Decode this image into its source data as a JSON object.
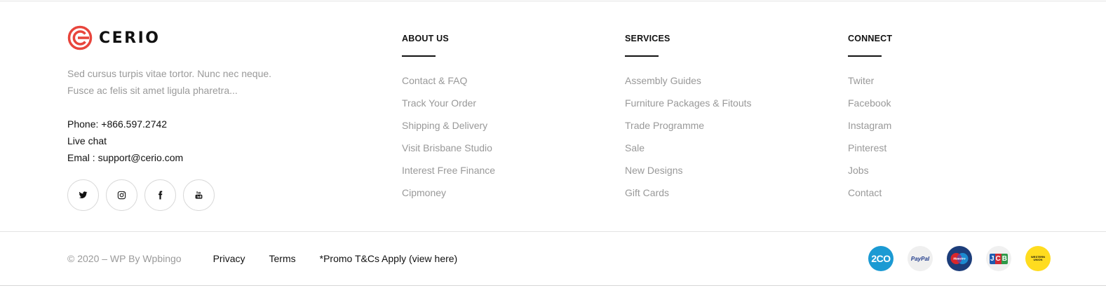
{
  "brand": {
    "name": "CERIO",
    "description": "Sed cursus turpis vitae tortor. Nunc nec neque. Fusce ac felis sit amet ligula pharetra..."
  },
  "contact": {
    "phone": "Phone: +866.597.2742",
    "livechat": "Live chat",
    "email": "Emal : support@cerio.com"
  },
  "social": [
    {
      "icon": "twitter-icon"
    },
    {
      "icon": "instagram-icon"
    },
    {
      "icon": "facebook-icon"
    },
    {
      "icon": "youtube-icon"
    }
  ],
  "columns": [
    {
      "title": "ABOUT US",
      "links": [
        "Contact & FAQ",
        "Track Your Order",
        "Shipping & Delivery",
        "Visit Brisbane Studio",
        "Interest Free Finance",
        "Cipmoney"
      ]
    },
    {
      "title": "SERVICES",
      "links": [
        "Assembly Guides",
        "Furniture Packages & Fitouts",
        "Trade Programme",
        "Sale",
        "New Designs",
        "Gift Cards"
      ]
    },
    {
      "title": "CONNECT",
      "links": [
        "Twiter",
        "Facebook",
        "Instagram",
        "Pinterest",
        "Jobs",
        "Contact"
      ]
    }
  ],
  "bottom": {
    "copyright": "© 2020 – WP By Wpbingo",
    "links": [
      "Privacy",
      "Terms",
      "*Promo T&Cs Apply (view here)"
    ]
  },
  "payments": {
    "twoco": "2CO",
    "paypal": "PayPal",
    "maestro": "Maestro",
    "jcb": {
      "j": "J",
      "c": "C",
      "b": "B"
    },
    "wu": {
      "line1": "WESTERN",
      "line2": "UNION"
    }
  },
  "colors": {
    "accent": "#e8453c",
    "muted_text": "#999999",
    "text": "#111111",
    "divider": "#e3e3e3"
  }
}
